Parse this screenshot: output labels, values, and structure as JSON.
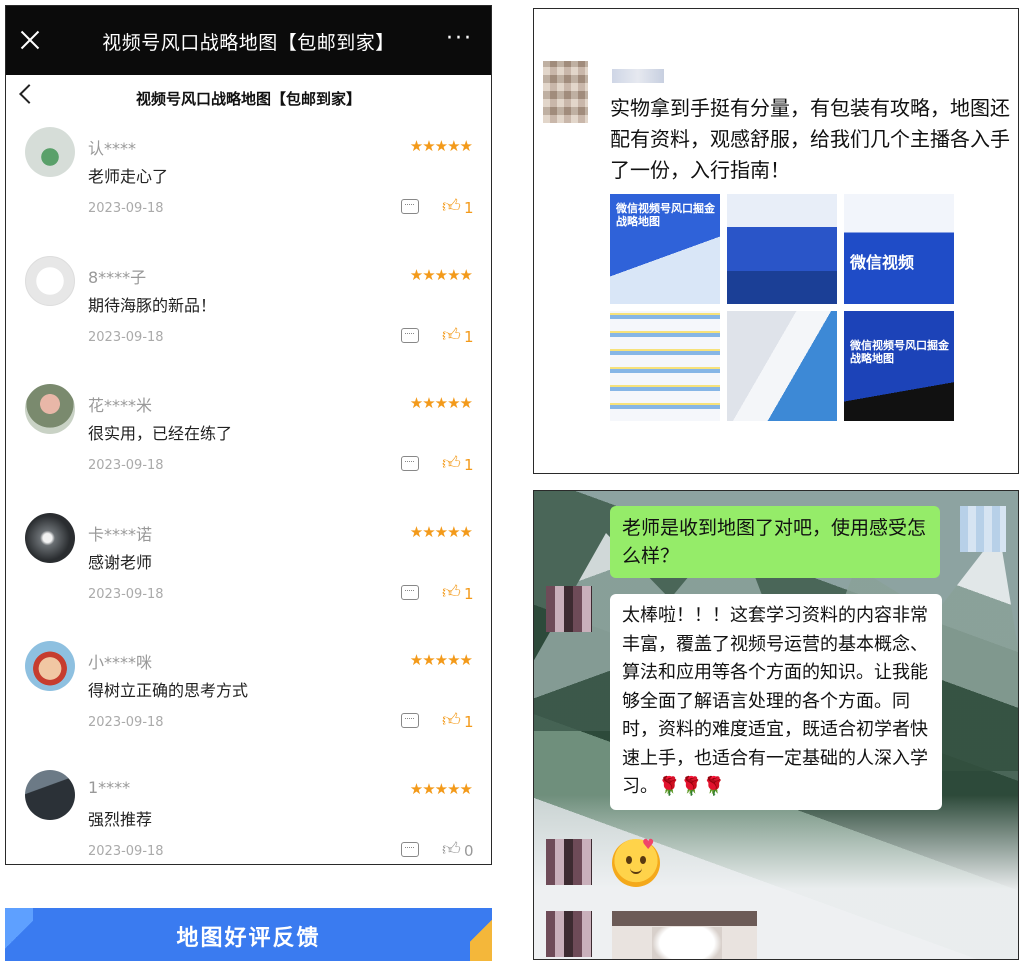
{
  "phone": {
    "topbar_title": "视频号风口战略地图【包邮到家】",
    "more_icon": "···",
    "subbar_title": "视频号风口战略地图【包邮到家】"
  },
  "reviews": [
    {
      "name": "认****",
      "stars": "★★★★★",
      "text": "老师走心了",
      "date": "2023-09-18",
      "likes": "1"
    },
    {
      "name": "8****子",
      "stars": "★★★★★",
      "text": "期待海豚的新品！",
      "date": "2023-09-18",
      "likes": "1"
    },
    {
      "name": "花****米",
      "stars": "★★★★★",
      "text": "很实用，已经在练了",
      "date": "2023-09-18",
      "likes": "1"
    },
    {
      "name": "卡****诺",
      "stars": "★★★★★",
      "text": "感谢老师",
      "date": "2023-09-18",
      "likes": "1"
    },
    {
      "name": "小****咪",
      "stars": "★★★★★",
      "text": "得树立正确的思考方式",
      "date": "2023-09-18",
      "likes": "1"
    },
    {
      "name": "1****",
      "stars": "★★★★★",
      "text": "强烈推荐",
      "date": "2023-09-18",
      "likes": "0"
    }
  ],
  "banner": {
    "label": "地图好评反馈"
  },
  "feed": {
    "text": "实物拿到手挺有分量，有包装有攻略，地图还配有资料，观感舒服，给我们几个主播各入手了一份，入行指南！",
    "photo_captions": [
      "微信视频号风口掘金战略地图",
      "微信视频",
      "微信视频号风口掘金战略地图"
    ]
  },
  "chat": {
    "question": "老师是收到地图了对吧，使用感受怎么样？",
    "answer": "太棒啦！！！这套学习资料的内容非常丰富，覆盖了视频号运营的基本概念、算法和应用等各个方面的知识。让我能够全面了解语言处理的各个方面。同时，资料的难度适宜，既适合初学者快速上手，也适合有一定基础的人深入学习。🌹🌹🌹"
  },
  "colors": {
    "star": "#f39a1a",
    "banner": "#3a7bf0",
    "bubble_green": "#95ec69"
  },
  "icons": {
    "close": "close-icon",
    "more": "more-icon",
    "back": "back-icon",
    "comment": "comment-icon",
    "like": "thumbs-up-icon"
  }
}
